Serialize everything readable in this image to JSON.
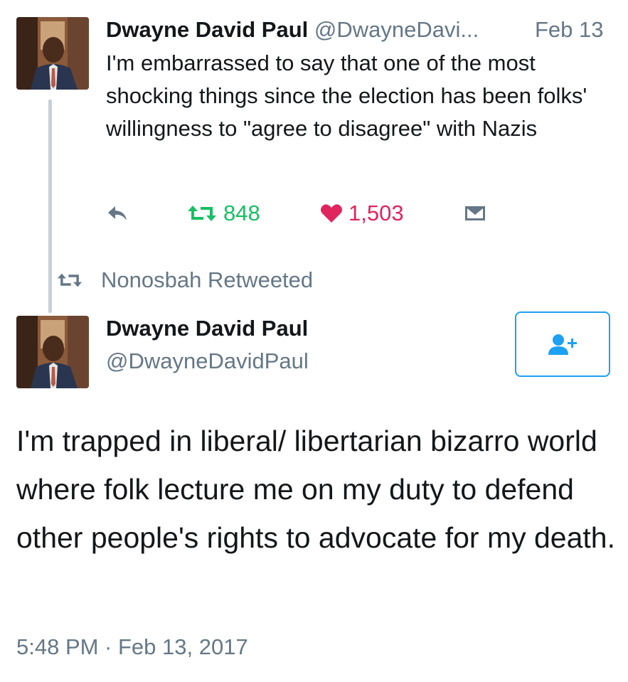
{
  "tweet1": {
    "author_name": "Dwayne David Paul",
    "author_handle": "@DwayneDavi...",
    "date": "Feb 13",
    "text": "I'm embarrassed to say that one of the most shocking things since the election has been folks' willingness to \"agree to disagree\" with Nazis",
    "retweet_count": "848",
    "like_count": "1,503"
  },
  "retweet_context": {
    "label": "Nonosbah Retweeted"
  },
  "tweet2": {
    "author_name": "Dwayne David Paul",
    "author_handle": "@DwayneDavidPaul",
    "text": "I'm trapped in liberal/ libertarian bizarro world where folk lecture me on my duty to defend other people's rights to advocate for my death.",
    "timestamp": "5:48 PM · Feb 13, 2017"
  },
  "icons": {
    "reply": "reply-icon",
    "retweet": "retweet-icon",
    "like": "heart-icon",
    "dm": "envelope-icon",
    "follow": "add-user-icon"
  },
  "colors": {
    "retweet": "#17bf63",
    "like": "#e0245e",
    "accent": "#1da1f2",
    "secondary_text": "#657786"
  }
}
